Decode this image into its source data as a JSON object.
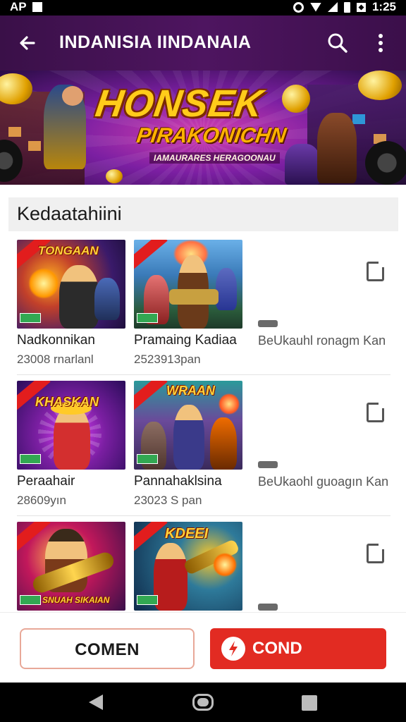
{
  "status_bar": {
    "left_text": "AP",
    "time": "1:25"
  },
  "app_bar": {
    "title": "INDANISIA IINDANAIA"
  },
  "banner": {
    "title": "HONSEK",
    "subtitle": "PIRAKONICHN",
    "tagline": "IAMAURARES HERAGOONAU"
  },
  "section": {
    "title": "Kedaatahiini"
  },
  "rows": [
    {
      "items": [
        {
          "name": "Nadkonnikan",
          "sub": "23008 rnarlanl",
          "art": "TONGAAN"
        },
        {
          "name": "Pramaing Kadiaa",
          "sub": "2523913pan",
          "art": ""
        }
      ],
      "desc": "BeUkauhl ronagm Kan"
    },
    {
      "items": [
        {
          "name": "Peraahair",
          "sub": "28609yın",
          "art": "KHASKAN"
        },
        {
          "name": "Pannahaklsina",
          "sub": "23023 S pan",
          "art": "WRAAN"
        }
      ],
      "desc": "BeUkaohl guoagın Kan"
    },
    {
      "items": [
        {
          "name": "",
          "sub": "",
          "art": "SNUAH SIKAIAN"
        },
        {
          "name": "",
          "sub": "",
          "art": "KDEEI"
        }
      ],
      "desc": ""
    }
  ],
  "buttons": {
    "comment": "COMEN",
    "cond": "COND"
  },
  "colors": {
    "app_bar": "#4e1560",
    "accent_red": "#e22b22",
    "title_gold": "#ffcc1a"
  }
}
